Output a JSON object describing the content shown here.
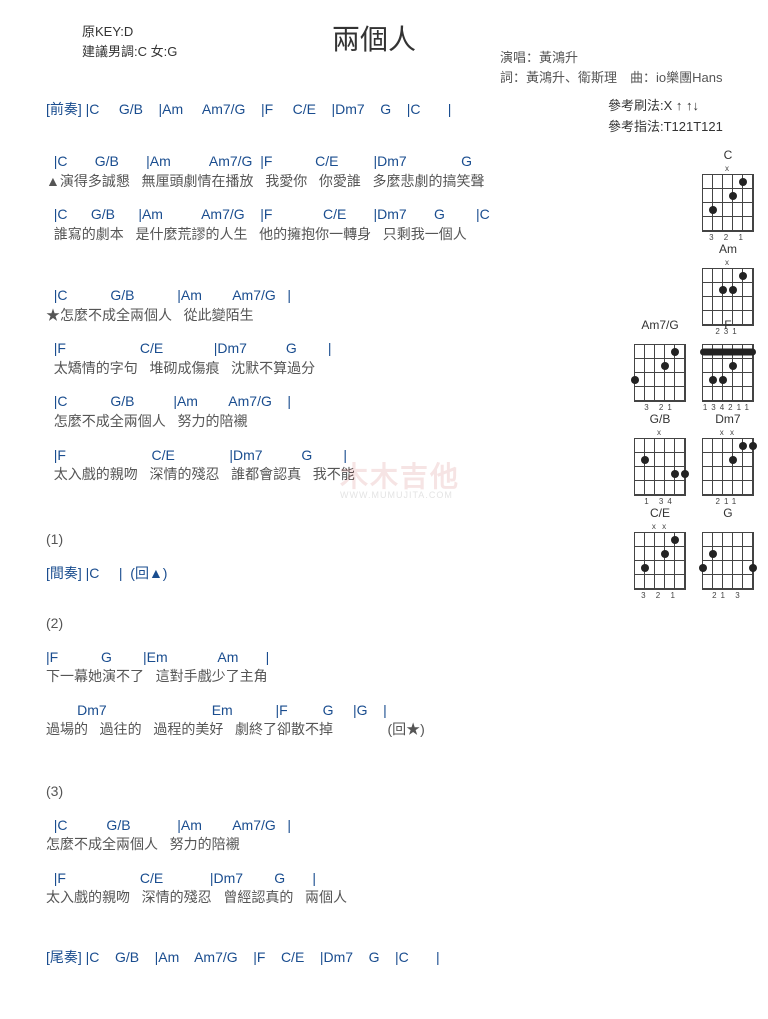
{
  "meta": {
    "key_label": "原KEY:D",
    "suggest": "建議男調:C 女:G",
    "title": "兩個人",
    "singer": "演唱：黃鴻升",
    "credits": "詞：黃鴻升、衛斯理　曲：io樂團Hans"
  },
  "strum": {
    "line1": "參考刷法:X ↑ ↑↓",
    "line2": "參考指法:T121T121"
  },
  "intro": {
    "label": "[前奏]",
    "chords": " |C     G/B    |Am     Am7/G    |F     C/E    |Dm7    G    |C       |"
  },
  "verse": {
    "c1": "  |C       G/B       |Am          Am7/G  |F           C/E         |Dm7              G",
    "l1": "▲演得多誠懇   無厘頭劇情在播放   我愛你   你愛誰   多麼悲劇的搞笑聲",
    "c2": "  |C      G/B      |Am          Am7/G    |F             C/E       |Dm7       G        |C",
    "l2": "  誰寫的劇本   是什麼荒謬的人生   他的擁抱你一轉身   只剩我一個人"
  },
  "chorus": {
    "c1": "  |C           G/B           |Am        Am7/G   |",
    "l1": "★怎麼不成全兩個人   從此變陌生",
    "c2": "  |F                   C/E             |Dm7          G        |",
    "l2": "  太矯情的字句   堆砌成傷痕   沈默不算過分",
    "c3": "  |C           G/B          |Am        Am7/G    |",
    "l3": "  怎麼不成全兩個人   努力的陪襯",
    "c4": "  |F                      C/E              |Dm7          G        |",
    "l4": "  太入戲的親吻   深情的殘忍   誰都會認真   我不能"
  },
  "section1": {
    "num": "(1)",
    "label": "[間奏]",
    "chords": " |C     |  (回▲)"
  },
  "section2": {
    "num": "(2)",
    "c1": "|F           G        |Em             Am       |",
    "l1": "下一幕她演不了   這對手戲少了主角",
    "c2": "        Dm7                           Em           |F         G     |G    |",
    "l2": "過場的   過往的   過程的美好   劇終了卻散不掉              (回★)"
  },
  "section3": {
    "num": "(3)",
    "c1": "  |C          G/B            |Am        Am7/G   |",
    "l1": "怎麼不成全兩個人   努力的陪襯",
    "c2": "  |F                   C/E            |Dm7        G       |",
    "l2": "太入戲的親吻   深情的殘忍   曾經認真的   兩個人"
  },
  "outro": {
    "label": "[尾奏]",
    "chords": " |C    G/B    |Am    Am7/G    |F    C/E    |Dm7    G    |C       |"
  },
  "watermark": {
    "main": "木木吉他",
    "sub": "WWW.MUMUJITA.COM"
  },
  "diagrams": {
    "c": "C",
    "am": "Am",
    "am7g": "Am7/G",
    "f": "F",
    "gb": "G/B",
    "dm7": "Dm7",
    "ce": "C/E",
    "g": "G",
    "open_x": "x",
    "open_xx": "x   x"
  },
  "chart_data": null
}
